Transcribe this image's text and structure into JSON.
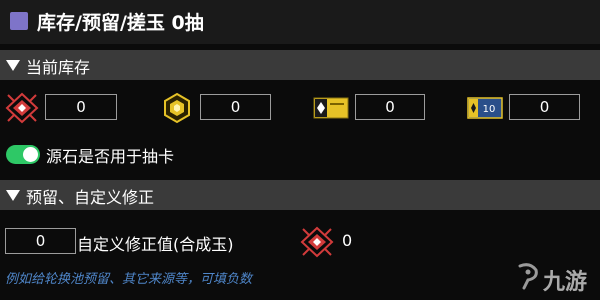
{
  "title": "库存/预留/搓玉 0抽",
  "sections": {
    "inventory": {
      "label": "当前库存"
    },
    "reserve": {
      "label": "预留、自定义修正"
    }
  },
  "inventory": {
    "orundum": "0",
    "originite_prime": "0",
    "headhunting_permit": "0",
    "headhunting_permit_10": "0"
  },
  "ten_pull_badge": "10",
  "toggle": {
    "label": "源石是否用于抽卡",
    "on": true
  },
  "custom": {
    "value": "0",
    "label": "自定义修正值(合成玉)",
    "result": "0"
  },
  "hint": "例如给轮换池预留、其它来源等，可填负数",
  "watermark": "九游",
  "icons": {
    "orundum": "orundum-icon",
    "originite": "originite-prime-icon",
    "permit": "headhunting-permit-icon",
    "permit10": "ten-headhunting-permit-icon"
  },
  "colors": {
    "accent": "#7e74c9",
    "toggle_on": "#2ec866",
    "hint": "#4f86c9",
    "orundum_red": "#d23b3b",
    "permit_gold": "#e6c227"
  }
}
